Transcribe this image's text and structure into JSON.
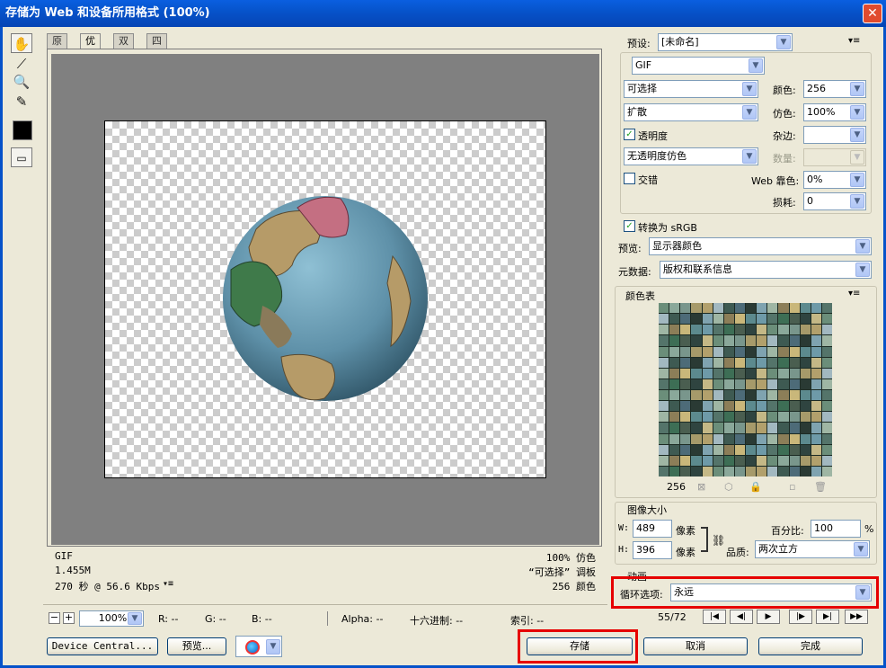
{
  "window": {
    "title": "存储为 Web 和设备所用格式 (100%)",
    "close": "✕"
  },
  "tabs": [
    "原稿",
    "优化",
    "双联",
    "四联"
  ],
  "info": {
    "left": [
      "GIF",
      "1.455M",
      "270 秒 @ 56.6 Kbps"
    ],
    "menu_glyph": "▾≡",
    "right": [
      "100% 仿色",
      "“可选择” 调板",
      "256 颜色"
    ]
  },
  "statusbar": {
    "zoom": "100%",
    "r": "R: --",
    "g": "G: --",
    "b": "B: --",
    "alpha": "Alpha: --",
    "hex": "十六进制: --",
    "index": "索引: --",
    "zoom_minus": "−",
    "zoom_plus": "+"
  },
  "buttons": {
    "device_central": "Device Central...",
    "preview": "预览...",
    "save": "存储",
    "cancel": "取消",
    "done": "完成"
  },
  "settings": {
    "preset_label": "预设:",
    "preset_value": "[未命名]",
    "format": "GIF",
    "reduction": "可选择",
    "dither_algo": "扩散",
    "transparency_label": "透明度",
    "transparency_checked": true,
    "matte_dither": "无透明度仿色",
    "interlaced_label": "交错",
    "interlaced_checked": false,
    "colors_label": "颜色:",
    "colors_value": "256",
    "dither_label": "仿色:",
    "dither_value": "100%",
    "matte_label": "杂边:",
    "amount_label": "数量:",
    "web_snap_label": "Web 靠色:",
    "web_snap_value": "0%",
    "lossy_label": "损耗:",
    "lossy_value": "0",
    "srgb_label": "转换为 sRGB",
    "srgb_checked": true,
    "preview_label": "预览:",
    "preview_value": "显示器颜色",
    "metadata_label": "元数据:",
    "metadata_value": "版权和联系信息"
  },
  "color_table": {
    "title": "颜色表",
    "count": "256"
  },
  "image_size": {
    "title": "图像大小",
    "w_label": "W:",
    "w_value": "489",
    "h_label": "H:",
    "h_value": "396",
    "unit": "像素",
    "percent_label": "百分比:",
    "percent_value": "100",
    "percent_unit": "%",
    "quality_label": "品质:",
    "quality_value": "两次立方"
  },
  "animation": {
    "title": "动画",
    "loop_label": "循环选项:",
    "loop_value": "永远",
    "frame": "55/72"
  },
  "colors": {
    "title_bar": "#0652c9",
    "highlight": "#e60000"
  },
  "icons": [
    "hand-icon",
    "slice-select-icon",
    "zoom-icon",
    "eyedropper-icon",
    "color-swatch-icon",
    "toggle-slices-icon",
    "link-icon",
    "browser-icon"
  ]
}
